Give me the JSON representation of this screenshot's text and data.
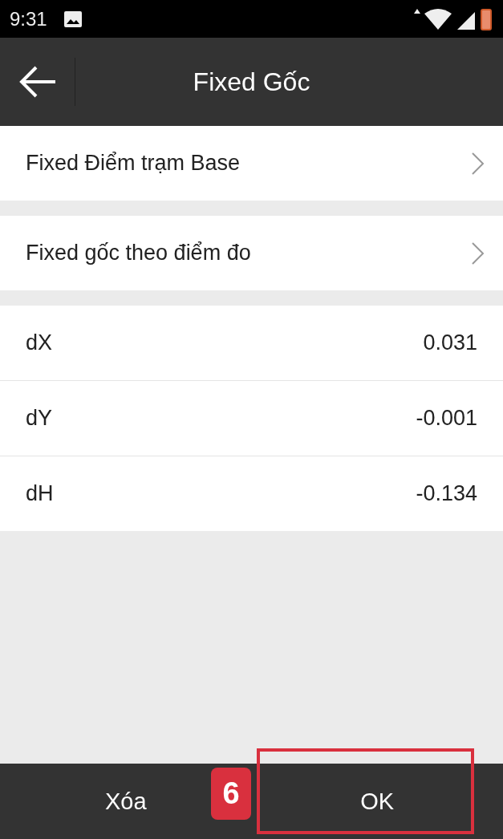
{
  "status_bar": {
    "time": "9:31"
  },
  "app_bar": {
    "title": "Fixed Gốc"
  },
  "menu_items": [
    {
      "label": "Fixed Điểm trạm Base"
    },
    {
      "label": "Fixed gốc theo điểm đo"
    }
  ],
  "values": [
    {
      "label": "dX",
      "value": "0.031"
    },
    {
      "label": "dY",
      "value": "-0.001"
    },
    {
      "label": "dH",
      "value": "-0.134"
    }
  ],
  "bottom_bar": {
    "buttons": [
      {
        "label": "Xóa",
        "highlighted": false
      },
      {
        "label": "OK",
        "highlighted": true,
        "step": "6"
      }
    ]
  }
}
